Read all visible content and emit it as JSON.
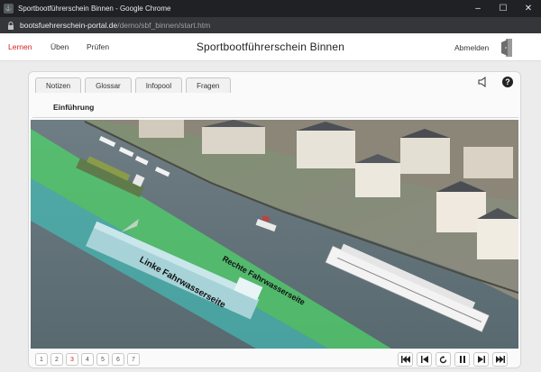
{
  "window": {
    "title": "Sportbootführerschein Binnen - Google Chrome",
    "address_host": "bootsfuehrerschein-portal.de",
    "address_path": "/demo/sbf_binnen/start.htm"
  },
  "nav": {
    "items": [
      "Lernen",
      "Üben",
      "Prüfen"
    ],
    "active": "Lernen",
    "title": "Sportbootführerschein Binnen",
    "logout_label": "Abmelden"
  },
  "tabs": [
    "Notizen",
    "Glossar",
    "Infopool",
    "Fragen"
  ],
  "content": {
    "section_title": "Einführung",
    "label_left": "Linke Fahrwasserseite",
    "label_right": "Rechte Fahrwasserseite"
  },
  "pager": {
    "pages": [
      "1",
      "2",
      "3",
      "4",
      "5",
      "6",
      "7"
    ],
    "current": "3"
  },
  "icons": {
    "sound": "speaker-icon",
    "help": "help-icon",
    "controls": [
      "first-icon",
      "previous-icon",
      "replay-icon",
      "pause-icon",
      "next-icon",
      "last-icon"
    ]
  },
  "colors": {
    "accent": "#d42020",
    "fairway_right": "#4fd16a",
    "fairway_left": "#3fc8c0"
  }
}
